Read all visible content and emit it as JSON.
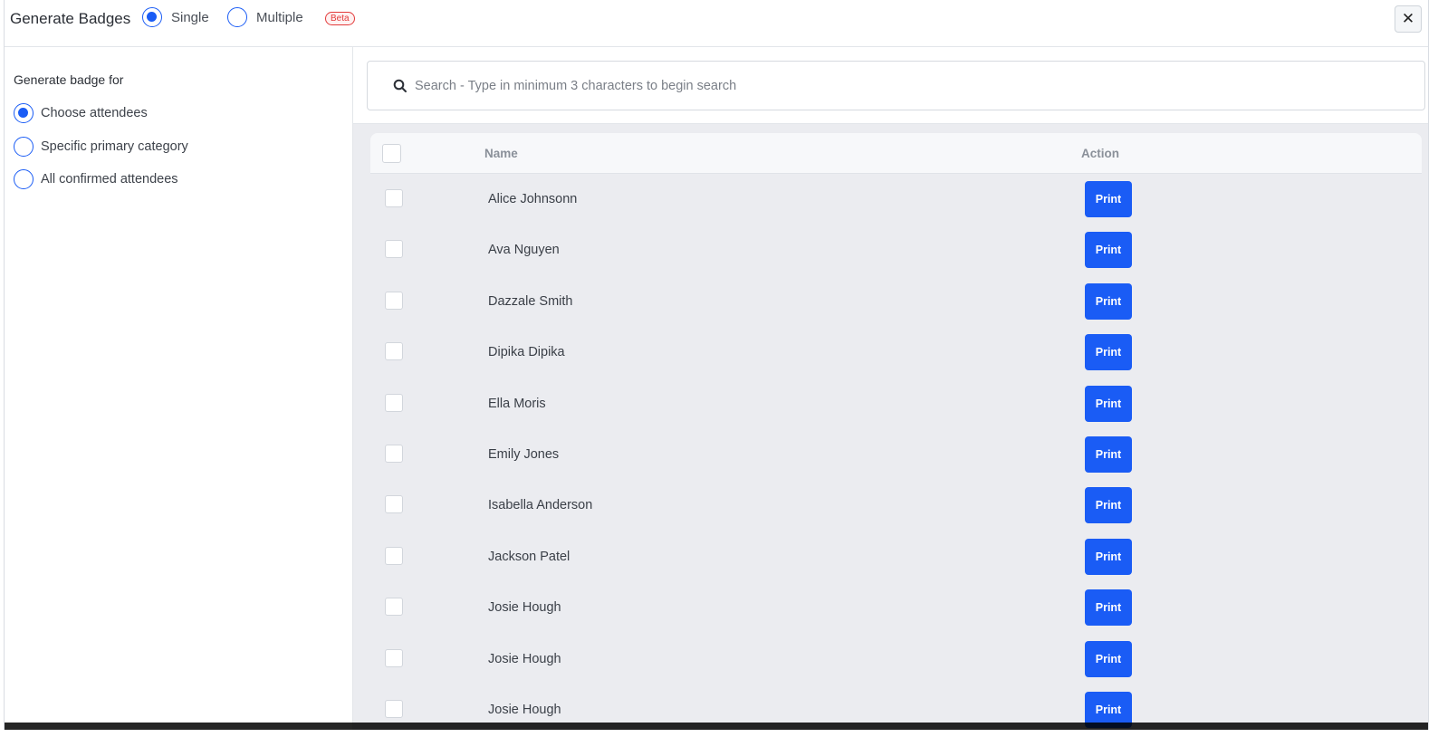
{
  "header": {
    "title": "Generate Badges",
    "mode_options": [
      {
        "label": "Single",
        "selected": true
      },
      {
        "label": "Multiple",
        "selected": false
      }
    ],
    "beta_badge": "Beta",
    "close_icon": "close-icon"
  },
  "sidebar": {
    "heading": "Generate badge for",
    "options": [
      {
        "label": "Choose attendees",
        "selected": true
      },
      {
        "label": "Specific primary category",
        "selected": false
      },
      {
        "label": "All confirmed attendees",
        "selected": false
      }
    ]
  },
  "search": {
    "placeholder": "Search - Type in minimum 3 characters to begin search",
    "value": ""
  },
  "table": {
    "columns": {
      "name": "Name",
      "action": "Action"
    },
    "action_label": "Print",
    "rows": [
      "Alice Johnsonn",
      "Ava Nguyen",
      "Dazzale Smith",
      "Dipika Dipika",
      "Ella Moris",
      "Emily Jones",
      "Isabella Anderson",
      "Jackson Patel",
      "Josie Hough",
      "Josie Hough",
      "Josie Hough"
    ]
  },
  "colors": {
    "accent": "#1a5cf5",
    "beta": "#e23b3b"
  }
}
